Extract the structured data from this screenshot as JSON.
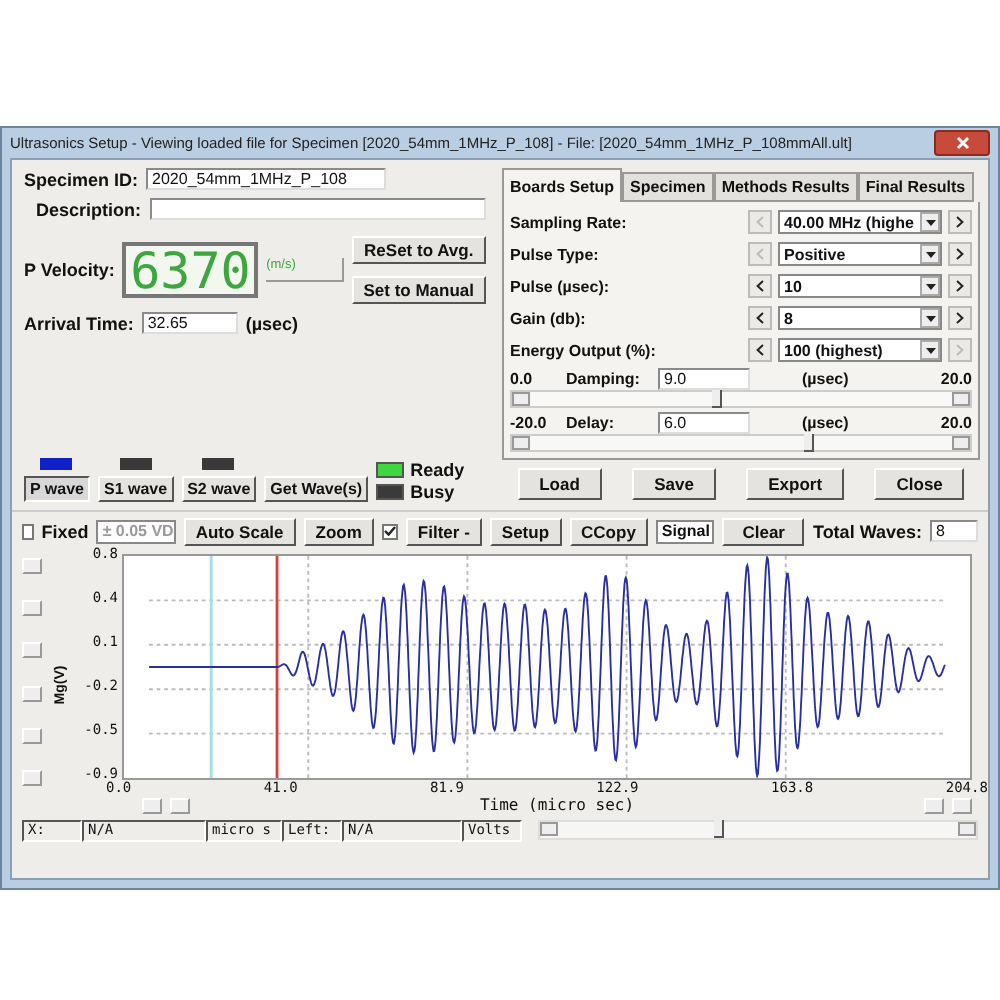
{
  "window": {
    "title": "Ultrasonics Setup - Viewing loaded file for Specimen [2020_54mm_1MHz_P_108] - File: [2020_54mm_1MHz_P_108mmAll.ult]"
  },
  "specimen": {
    "id_label": "Specimen ID:",
    "id_value": "2020_54mm_1MHz_P_108",
    "description_label": "Description:"
  },
  "velocity": {
    "label": "P Velocity:",
    "value": "6370",
    "unit": "(m/s)"
  },
  "velocity_buttons": [
    "ReSet to Avg.",
    "Set to Manual"
  ],
  "arrival": {
    "label": "Arrival Time:",
    "value": "32.65",
    "unit": "(µsec)"
  },
  "wave_buttons": [
    {
      "label": "P wave",
      "selected": true
    },
    {
      "label": "S1 wave",
      "selected": false
    },
    {
      "label": "S2 wave",
      "selected": false
    }
  ],
  "get_waves": "Get Wave(s)",
  "status_lights": [
    {
      "label": "Ready",
      "on": true
    },
    {
      "label": "Busy",
      "on": false
    }
  ],
  "tabs": [
    {
      "label": "Boards Setup",
      "selected": true
    },
    {
      "label": "Specimen",
      "selected": false
    },
    {
      "label": "Methods Results",
      "selected": false
    },
    {
      "label": "Final Results",
      "selected": false
    }
  ],
  "settings": [
    {
      "label": "Sampling Rate:",
      "value": "40.00 MHz (highe",
      "prev_disabled": true,
      "next_disabled": false
    },
    {
      "label": "Pulse Type:",
      "value": "Positive",
      "prev_disabled": true,
      "next_disabled": false
    },
    {
      "label": "Pulse (µsec):",
      "value": "10",
      "prev_disabled": false,
      "next_disabled": false
    },
    {
      "label": "Gain (db):",
      "value": "8",
      "prev_disabled": false,
      "next_disabled": false
    },
    {
      "label": "Energy Output (%):",
      "value": "100 (highest)",
      "prev_disabled": false,
      "next_disabled": true
    }
  ],
  "sliders": [
    {
      "min": "0.0",
      "label": "Damping:",
      "value": "9.0",
      "unit": "(µsec)",
      "max": "20.0",
      "level": 0.45
    },
    {
      "min": "-20.0",
      "label": "Delay:",
      "value": "6.0",
      "unit": "(µsec)",
      "max": "20.0",
      "level": 0.65
    }
  ],
  "actions": [
    "Load",
    "Save",
    "Export",
    "Close"
  ],
  "toolbar": {
    "fixed": {
      "label": "Fixed",
      "checked": false
    },
    "scale": "± 0.05 VD",
    "auto_scale": "Auto Scale",
    "zoom": "Zoom",
    "filter": {
      "label": "Filter -",
      "checked": true
    },
    "setup": "Setup",
    "ccopy": "CCopy",
    "signal": "Signal",
    "clear": "Clear",
    "total_label": "Total Waves:",
    "total_value": "8"
  },
  "plot": {
    "ylabel": "Mg(V)",
    "yticks": [
      "0.8",
      "0.4",
      "0.1",
      "-0.2",
      "-0.5",
      "-0.9"
    ],
    "xticks": [
      "0.0",
      "41.0",
      "81.9",
      "122.9",
      "163.8",
      "204.8"
    ],
    "xlabel": "Time (micro sec)"
  },
  "status_bar": [
    "X:",
    "N/A",
    "micro s",
    "Left:",
    "N/A",
    "Volts"
  ]
}
